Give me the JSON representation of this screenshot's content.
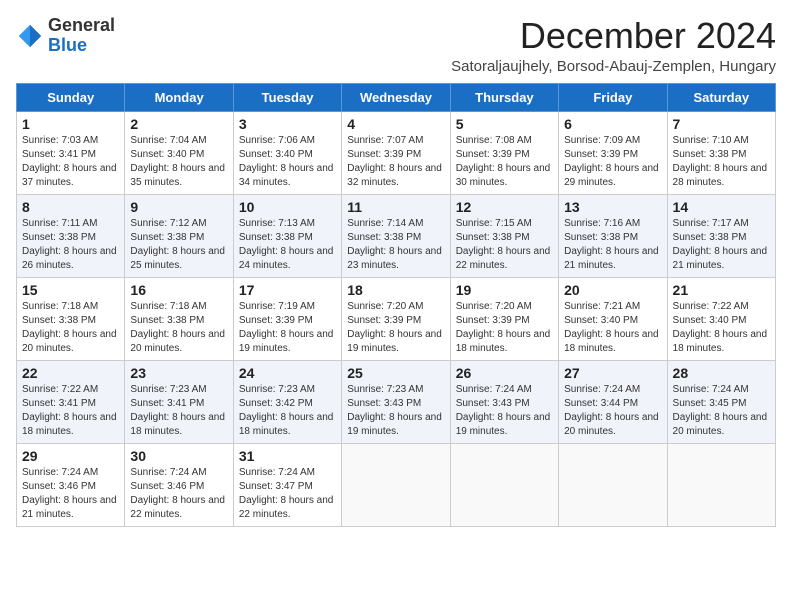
{
  "logo": {
    "general": "General",
    "blue": "Blue"
  },
  "header": {
    "month": "December 2024",
    "location": "Satoraljaujhely, Borsod-Abauj-Zemplen, Hungary"
  },
  "days_of_week": [
    "Sunday",
    "Monday",
    "Tuesday",
    "Wednesday",
    "Thursday",
    "Friday",
    "Saturday"
  ],
  "weeks": [
    [
      {
        "day": 1,
        "sunrise": "7:03 AM",
        "sunset": "3:41 PM",
        "daylight": "8 hours and 37 minutes."
      },
      {
        "day": 2,
        "sunrise": "7:04 AM",
        "sunset": "3:40 PM",
        "daylight": "8 hours and 35 minutes."
      },
      {
        "day": 3,
        "sunrise": "7:06 AM",
        "sunset": "3:40 PM",
        "daylight": "8 hours and 34 minutes."
      },
      {
        "day": 4,
        "sunrise": "7:07 AM",
        "sunset": "3:39 PM",
        "daylight": "8 hours and 32 minutes."
      },
      {
        "day": 5,
        "sunrise": "7:08 AM",
        "sunset": "3:39 PM",
        "daylight": "8 hours and 30 minutes."
      },
      {
        "day": 6,
        "sunrise": "7:09 AM",
        "sunset": "3:39 PM",
        "daylight": "8 hours and 29 minutes."
      },
      {
        "day": 7,
        "sunrise": "7:10 AM",
        "sunset": "3:38 PM",
        "daylight": "8 hours and 28 minutes."
      }
    ],
    [
      {
        "day": 8,
        "sunrise": "7:11 AM",
        "sunset": "3:38 PM",
        "daylight": "8 hours and 26 minutes."
      },
      {
        "day": 9,
        "sunrise": "7:12 AM",
        "sunset": "3:38 PM",
        "daylight": "8 hours and 25 minutes."
      },
      {
        "day": 10,
        "sunrise": "7:13 AM",
        "sunset": "3:38 PM",
        "daylight": "8 hours and 24 minutes."
      },
      {
        "day": 11,
        "sunrise": "7:14 AM",
        "sunset": "3:38 PM",
        "daylight": "8 hours and 23 minutes."
      },
      {
        "day": 12,
        "sunrise": "7:15 AM",
        "sunset": "3:38 PM",
        "daylight": "8 hours and 22 minutes."
      },
      {
        "day": 13,
        "sunrise": "7:16 AM",
        "sunset": "3:38 PM",
        "daylight": "8 hours and 21 minutes."
      },
      {
        "day": 14,
        "sunrise": "7:17 AM",
        "sunset": "3:38 PM",
        "daylight": "8 hours and 21 minutes."
      }
    ],
    [
      {
        "day": 15,
        "sunrise": "7:18 AM",
        "sunset": "3:38 PM",
        "daylight": "8 hours and 20 minutes."
      },
      {
        "day": 16,
        "sunrise": "7:18 AM",
        "sunset": "3:38 PM",
        "daylight": "8 hours and 20 minutes."
      },
      {
        "day": 17,
        "sunrise": "7:19 AM",
        "sunset": "3:39 PM",
        "daylight": "8 hours and 19 minutes."
      },
      {
        "day": 18,
        "sunrise": "7:20 AM",
        "sunset": "3:39 PM",
        "daylight": "8 hours and 19 minutes."
      },
      {
        "day": 19,
        "sunrise": "7:20 AM",
        "sunset": "3:39 PM",
        "daylight": "8 hours and 18 minutes."
      },
      {
        "day": 20,
        "sunrise": "7:21 AM",
        "sunset": "3:40 PM",
        "daylight": "8 hours and 18 minutes."
      },
      {
        "day": 21,
        "sunrise": "7:22 AM",
        "sunset": "3:40 PM",
        "daylight": "8 hours and 18 minutes."
      }
    ],
    [
      {
        "day": 22,
        "sunrise": "7:22 AM",
        "sunset": "3:41 PM",
        "daylight": "8 hours and 18 minutes."
      },
      {
        "day": 23,
        "sunrise": "7:23 AM",
        "sunset": "3:41 PM",
        "daylight": "8 hours and 18 minutes."
      },
      {
        "day": 24,
        "sunrise": "7:23 AM",
        "sunset": "3:42 PM",
        "daylight": "8 hours and 18 minutes."
      },
      {
        "day": 25,
        "sunrise": "7:23 AM",
        "sunset": "3:43 PM",
        "daylight": "8 hours and 19 minutes."
      },
      {
        "day": 26,
        "sunrise": "7:24 AM",
        "sunset": "3:43 PM",
        "daylight": "8 hours and 19 minutes."
      },
      {
        "day": 27,
        "sunrise": "7:24 AM",
        "sunset": "3:44 PM",
        "daylight": "8 hours and 20 minutes."
      },
      {
        "day": 28,
        "sunrise": "7:24 AM",
        "sunset": "3:45 PM",
        "daylight": "8 hours and 20 minutes."
      }
    ],
    [
      {
        "day": 29,
        "sunrise": "7:24 AM",
        "sunset": "3:46 PM",
        "daylight": "8 hours and 21 minutes."
      },
      {
        "day": 30,
        "sunrise": "7:24 AM",
        "sunset": "3:46 PM",
        "daylight": "8 hours and 22 minutes."
      },
      {
        "day": 31,
        "sunrise": "7:24 AM",
        "sunset": "3:47 PM",
        "daylight": "8 hours and 22 minutes."
      },
      null,
      null,
      null,
      null
    ]
  ]
}
